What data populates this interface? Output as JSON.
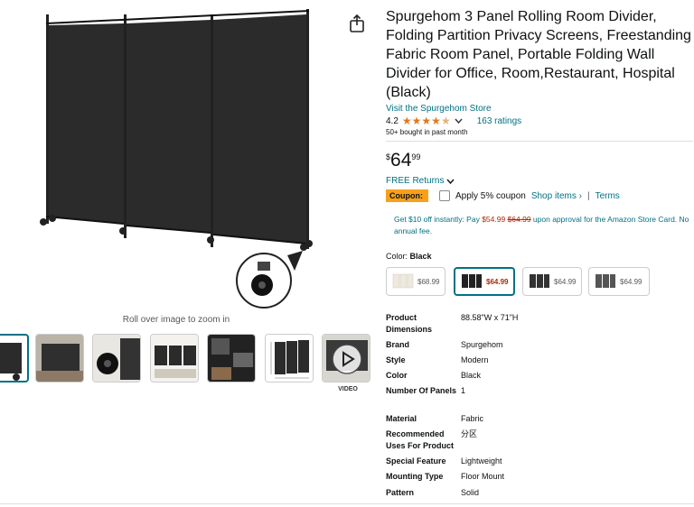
{
  "product": {
    "title": "Spurgehom 3 Panel Rolling Room Divider, Folding Partition Privacy Screens, Freestanding Fabric Room Panel, Portable Folding Wall Divider for Office, Room,Restaurant, Hospital (Black)",
    "store_link": "Visit the Spurgehom Store",
    "rating_value": "4.2",
    "rating_stars": 4.2,
    "ratings_count": "163 ratings",
    "bought_text": "50+ bought in past month"
  },
  "price": {
    "symbol": "$",
    "whole": "64",
    "fraction": "99"
  },
  "returns": {
    "label": "FREE Returns"
  },
  "coupon": {
    "badge": "Coupon:",
    "label": "Apply 5% coupon",
    "shop_items": "Shop items ›",
    "separator": "|",
    "terms": "Terms"
  },
  "offer": {
    "prefix": "Get $10 off instantly: Pay ",
    "pay_price": "$54.99",
    "strike_price": "$64.99",
    "suffix": " upon approval for the Amazon Store Card. No annual fee."
  },
  "color": {
    "label": "Color:",
    "selected": "Black",
    "options": [
      {
        "price": "$68.99",
        "swatch": "#e8e0d2"
      },
      {
        "price": "$64.99",
        "swatch": "#222222"
      },
      {
        "price": "$64.99",
        "swatch": "#333333"
      },
      {
        "price": "$64.99",
        "swatch": "#555555"
      }
    ]
  },
  "specs": [
    {
      "key": "Product Dimensions",
      "value": "88.58\"W x 71\"H"
    },
    {
      "key": "Brand",
      "value": "Spurgehom"
    },
    {
      "key": "Style",
      "value": "Modern"
    },
    {
      "key": "Color",
      "value": "Black"
    },
    {
      "key": "Number Of Panels",
      "value": "1"
    },
    {
      "key": "Material",
      "value": "Fabric"
    },
    {
      "key": "Recommended Uses For Product",
      "value": "分区"
    },
    {
      "key": "Special Feature",
      "value": "Lightweight"
    },
    {
      "key": "Mounting Type",
      "value": "Floor Mount"
    },
    {
      "key": "Pattern",
      "value": "Solid"
    }
  ],
  "media": {
    "zoom_hint": "Roll over image to zoom in",
    "video_label": "VIDEO"
  },
  "icons": {
    "share": "share-icon",
    "chevron": "chevron-down-icon",
    "play": "play-icon"
  },
  "colors": {
    "link": "#007185",
    "star": "#de7921",
    "price_red": "#b12704",
    "coupon": "#f7a11a"
  }
}
